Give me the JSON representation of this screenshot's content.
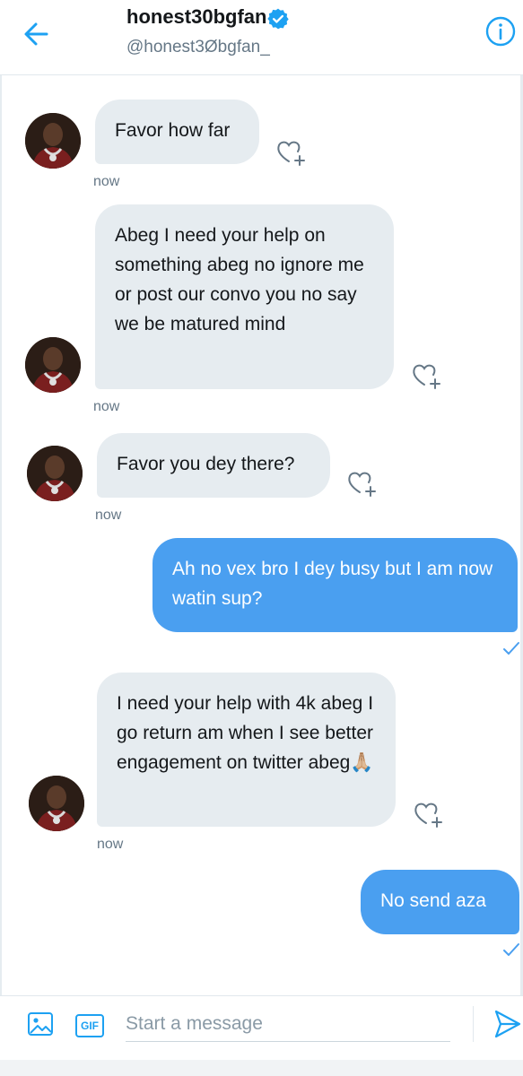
{
  "header": {
    "display_name": "honest30bgfan",
    "handle": "@honest3Øbgfan_",
    "back_icon": "arrow-left-icon",
    "verified_icon": "verified-badge-icon",
    "info_icon": "info-icon"
  },
  "colors": {
    "accent": "#1da1f2",
    "outgoing_bubble": "#4a9ff0",
    "incoming_bubble": "#e6ecf0"
  },
  "messages": [
    {
      "direction": "in",
      "text": "Favor how far",
      "timestamp": "now"
    },
    {
      "direction": "in",
      "text": "Abeg I need your help on something abeg no ignore me or post our convo you no say we be matured mind",
      "timestamp": "now"
    },
    {
      "direction": "in",
      "text": "Favor you dey there?",
      "timestamp": "now"
    },
    {
      "direction": "out",
      "text": "Ah no vex bro I dey busy but I am now watin sup?"
    },
    {
      "direction": "in",
      "text": "I need your help with 4k abeg I go return am when I see better engagement on twitter abeg🙏🏼",
      "timestamp": "now"
    },
    {
      "direction": "out",
      "text": "No  send aza"
    }
  ],
  "composer": {
    "placeholder": "Start a message",
    "gif_label": "GIF",
    "image_icon": "image-icon",
    "send_icon": "send-icon"
  }
}
